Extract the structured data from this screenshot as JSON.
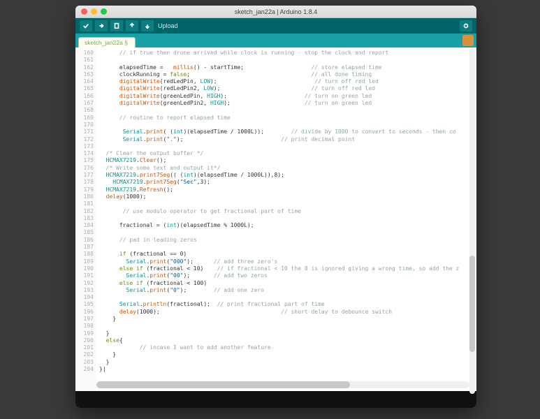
{
  "title": "sketch_jan22a | Arduino 1.8.4",
  "toolbar": {
    "upload_label": "Upload"
  },
  "tab": {
    "name": "sketch_jan22a §"
  },
  "line_start": 160,
  "line_end": 204,
  "code_lines": [
    {
      "n": 160,
      "seg": [
        [
          "      ",
          ""
        ],
        [
          "// if true then drone arrived while clock is running - stop the clock and report",
          "cm"
        ]
      ]
    },
    {
      "n": 161,
      "seg": [
        [
          "",
          ""
        ]
      ]
    },
    {
      "n": 162,
      "seg": [
        [
          "      elapsedTime =   ",
          ""
        ],
        [
          "millis",
          "fn"
        ],
        [
          "() - startTime;                    ",
          ""
        ],
        [
          "// store elapsed time",
          "cm"
        ]
      ]
    },
    {
      "n": 163,
      "seg": [
        [
          "      clockRunning = ",
          ""
        ],
        [
          "false",
          "kw"
        ],
        [
          ";                                    ",
          ""
        ],
        [
          "// all done timing",
          "cm"
        ]
      ]
    },
    {
      "n": 164,
      "seg": [
        [
          "      ",
          ""
        ],
        [
          "digitalWrite",
          "fn"
        ],
        [
          "(redLedPin, ",
          ""
        ],
        [
          "LOW",
          "ty"
        ],
        [
          ");                             ",
          ""
        ],
        [
          "// turn off red led",
          "cm"
        ]
      ]
    },
    {
      "n": 165,
      "seg": [
        [
          "      ",
          ""
        ],
        [
          "digitalWrite",
          "fn"
        ],
        [
          "(redLedPin2, ",
          ""
        ],
        [
          "LOW",
          "ty"
        ],
        [
          ");                           ",
          ""
        ],
        [
          "// turn off red led",
          "cm"
        ]
      ]
    },
    {
      "n": 166,
      "seg": [
        [
          "      ",
          ""
        ],
        [
          "digitalWrite",
          "fn"
        ],
        [
          "(greenLedPin, ",
          ""
        ],
        [
          "HIGH",
          "ty"
        ],
        [
          ");                       ",
          ""
        ],
        [
          "// turn on green led",
          "cm"
        ]
      ]
    },
    {
      "n": 167,
      "seg": [
        [
          "      ",
          ""
        ],
        [
          "digitalWrite",
          "fn"
        ],
        [
          "(greenLedPin2, ",
          ""
        ],
        [
          "HIGH",
          "ty"
        ],
        [
          ");                      ",
          ""
        ],
        [
          "// turn on green led",
          "cm"
        ]
      ]
    },
    {
      "n": 168,
      "seg": [
        [
          "",
          ""
        ]
      ]
    },
    {
      "n": 169,
      "seg": [
        [
          "      ",
          ""
        ],
        [
          "// routine to report elapsed time",
          "cm"
        ]
      ]
    },
    {
      "n": 170,
      "seg": [
        [
          "",
          ""
        ]
      ]
    },
    {
      "n": 171,
      "seg": [
        [
          "       ",
          ""
        ],
        [
          "Serial",
          "ty"
        ],
        [
          ".",
          ""
        ],
        [
          "print",
          "fn"
        ],
        [
          "( (",
          ""
        ],
        [
          "int",
          "ty"
        ],
        [
          ")(elapsedTime / 1000L));        ",
          ""
        ],
        [
          "// divide by 1000 to convert to seconds - then co",
          "cm"
        ]
      ]
    },
    {
      "n": 172,
      "seg": [
        [
          "       ",
          ""
        ],
        [
          "Serial",
          "ty"
        ],
        [
          ".",
          ""
        ],
        [
          "print",
          "fn"
        ],
        [
          "(",
          ""
        ],
        [
          "\".\"",
          "st"
        ],
        [
          ");                             ",
          ""
        ],
        [
          "// print decimal point",
          "cm"
        ]
      ]
    },
    {
      "n": 173,
      "seg": [
        [
          "",
          ""
        ]
      ]
    },
    {
      "n": 174,
      "seg": [
        [
          "  ",
          ""
        ],
        [
          "/* Clear the output buffer */",
          "cm"
        ]
      ]
    },
    {
      "n": 175,
      "seg": [
        [
          "  ",
          ""
        ],
        [
          "HCMAX7219",
          "ty"
        ],
        [
          ".",
          ""
        ],
        [
          "Clear",
          "fn"
        ],
        [
          "();",
          ""
        ]
      ]
    },
    {
      "n": 176,
      "seg": [
        [
          "  ",
          ""
        ],
        [
          "/* Write some text and output it*/",
          "cm"
        ]
      ]
    },
    {
      "n": 177,
      "seg": [
        [
          "  ",
          ""
        ],
        [
          "HCMAX7219",
          "ty"
        ],
        [
          ".",
          ""
        ],
        [
          "print7Seg",
          "fn"
        ],
        [
          "(( (",
          ""
        ],
        [
          "int",
          "ty"
        ],
        [
          ")(elapsedTime / 1000L)),8);",
          ""
        ]
      ]
    },
    {
      "n": 178,
      "seg": [
        [
          "    ",
          ""
        ],
        [
          "HCMAX7219",
          "ty"
        ],
        [
          ".",
          ""
        ],
        [
          "print7Seg",
          "fn"
        ],
        [
          "(",
          ""
        ],
        [
          "\"Sec\"",
          "st"
        ],
        [
          ",3);",
          ""
        ]
      ]
    },
    {
      "n": 179,
      "seg": [
        [
          "  ",
          ""
        ],
        [
          "HCMAX7219",
          "ty"
        ],
        [
          ".",
          ""
        ],
        [
          "Refresh",
          "fn"
        ],
        [
          "();",
          ""
        ]
      ]
    },
    {
      "n": 180,
      "seg": [
        [
          "  ",
          ""
        ],
        [
          "delay",
          "fn"
        ],
        [
          "(1000);",
          ""
        ]
      ]
    },
    {
      "n": 181,
      "seg": [
        [
          "",
          ""
        ]
      ]
    },
    {
      "n": 182,
      "seg": [
        [
          "       ",
          ""
        ],
        [
          "// use modulo operator to get fractional part of time",
          "cm"
        ]
      ]
    },
    {
      "n": 183,
      "seg": [
        [
          "",
          ""
        ]
      ]
    },
    {
      "n": 184,
      "seg": [
        [
          "      fractional = (",
          ""
        ],
        [
          "int",
          "ty"
        ],
        [
          ")(elapsedTime % 1000L);",
          ""
        ]
      ]
    },
    {
      "n": 185,
      "seg": [
        [
          "",
          ""
        ]
      ]
    },
    {
      "n": 186,
      "seg": [
        [
          "      ",
          ""
        ],
        [
          "// pad in leading zeros",
          "cm"
        ]
      ]
    },
    {
      "n": 187,
      "seg": [
        [
          "",
          ""
        ]
      ]
    },
    {
      "n": 188,
      "seg": [
        [
          "      ",
          ""
        ],
        [
          "if",
          "kw"
        ],
        [
          " (fractional == 0)",
          ""
        ]
      ]
    },
    {
      "n": 189,
      "seg": [
        [
          "        ",
          ""
        ],
        [
          "Serial",
          "ty"
        ],
        [
          ".",
          ""
        ],
        [
          "print",
          "fn"
        ],
        [
          "(",
          ""
        ],
        [
          "\"000\"",
          "st"
        ],
        [
          ");      ",
          ""
        ],
        [
          "// add three zero's",
          "cm"
        ]
      ]
    },
    {
      "n": 190,
      "seg": [
        [
          "      ",
          ""
        ],
        [
          "else if",
          "kw"
        ],
        [
          " (fractional < 10)    ",
          ""
        ],
        [
          "// if fractional < 10 the 0 is ignored giving a wrong time, so add the z",
          "cm"
        ]
      ]
    },
    {
      "n": 191,
      "seg": [
        [
          "        ",
          ""
        ],
        [
          "Serial",
          "ty"
        ],
        [
          ".",
          ""
        ],
        [
          "print",
          "fn"
        ],
        [
          "(",
          ""
        ],
        [
          "\"00\"",
          "st"
        ],
        [
          ");       ",
          ""
        ],
        [
          "// add two zeros",
          "cm"
        ]
      ]
    },
    {
      "n": 192,
      "seg": [
        [
          "      ",
          ""
        ],
        [
          "else if",
          "kw"
        ],
        [
          " (fractional < 100)",
          ""
        ]
      ]
    },
    {
      "n": 193,
      "seg": [
        [
          "        ",
          ""
        ],
        [
          "Serial",
          "ty"
        ],
        [
          ".",
          ""
        ],
        [
          "print",
          "fn"
        ],
        [
          "(",
          ""
        ],
        [
          "\"0\"",
          "st"
        ],
        [
          ");        ",
          ""
        ],
        [
          "// add one zero",
          "cm"
        ]
      ]
    },
    {
      "n": 194,
      "seg": [
        [
          "",
          ""
        ]
      ]
    },
    {
      "n": 195,
      "seg": [
        [
          "      ",
          ""
        ],
        [
          "Serial",
          "ty"
        ],
        [
          ".",
          ""
        ],
        [
          "println",
          "fn"
        ],
        [
          "(fractional);  ",
          ""
        ],
        [
          "// print fractional part of time",
          "cm"
        ]
      ]
    },
    {
      "n": 196,
      "seg": [
        [
          "      ",
          ""
        ],
        [
          "delay",
          "fn"
        ],
        [
          "(1000);                                    ",
          ""
        ],
        [
          "// short delay to debounce switch",
          "cm"
        ]
      ]
    },
    {
      "n": 197,
      "seg": [
        [
          "    }",
          ""
        ]
      ]
    },
    {
      "n": 198,
      "seg": [
        [
          "",
          ""
        ]
      ]
    },
    {
      "n": 199,
      "seg": [
        [
          "  }",
          ""
        ]
      ]
    },
    {
      "n": 200,
      "seg": [
        [
          "  ",
          ""
        ],
        [
          "else",
          "kw"
        ],
        [
          "{",
          ""
        ]
      ]
    },
    {
      "n": 201,
      "seg": [
        [
          "            ",
          ""
        ],
        [
          "// incase I want to add another feature",
          "cm"
        ]
      ]
    },
    {
      "n": 202,
      "seg": [
        [
          "    }",
          ""
        ]
      ]
    },
    {
      "n": 203,
      "seg": [
        [
          "  }",
          ""
        ]
      ]
    },
    {
      "n": 204,
      "seg": [
        [
          "}|",
          ""
        ]
      ]
    }
  ]
}
